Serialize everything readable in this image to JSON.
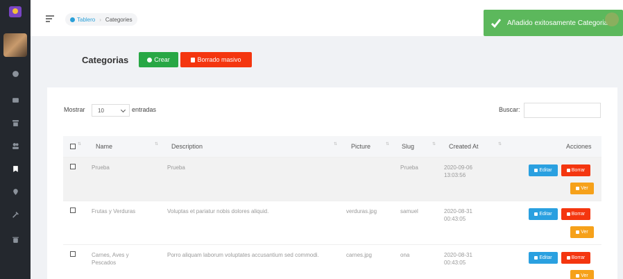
{
  "topbar": {
    "breadcrumb": {
      "home": "Tablero",
      "separator": "›",
      "current": "Categories"
    }
  },
  "toast": {
    "message": "Añadido exitosamente Categoria",
    "color": "#5cb85c"
  },
  "page": {
    "title": "Categorias",
    "create_label": "Crear",
    "bulk_delete_label": "Borrado masivo"
  },
  "table_controls": {
    "show_label": "Mostrar",
    "page_size": "10",
    "entries_label": "entradas",
    "search_label": "Buscar:",
    "search_value": ""
  },
  "table": {
    "columns": [
      "Name",
      "Description",
      "Picture",
      "Slug",
      "Created At",
      "Acciones"
    ],
    "rows": [
      {
        "name": "Prueba",
        "description": "Prueba",
        "picture": "",
        "slug": "Prueba",
        "created_date": "2020-09-06",
        "created_time": "13:03:56"
      },
      {
        "name": "Frutas y Verduras",
        "description": "Voluptas et pariatur nobis dolores aliquid.",
        "picture": "verduras.jpg",
        "slug": "samuel",
        "created_date": "2020-08-31",
        "created_time": "00:43:05"
      },
      {
        "name": "Carnes, Aves y Pescados",
        "description": "Porro aliquam laborum voluptates accusantium sed commodi.",
        "picture": "carnes.jpg",
        "slug": "ona",
        "created_date": "2020-08-31",
        "created_time": "00:43:05"
      }
    ],
    "actions": {
      "edit": "Editar",
      "delete": "Borrar",
      "view": "Ver"
    }
  },
  "colors": {
    "sidebar": "#24282e",
    "create": "#28a745",
    "delete": "#f4360f",
    "edit": "#2aa0e0",
    "view": "#f6a11a"
  }
}
